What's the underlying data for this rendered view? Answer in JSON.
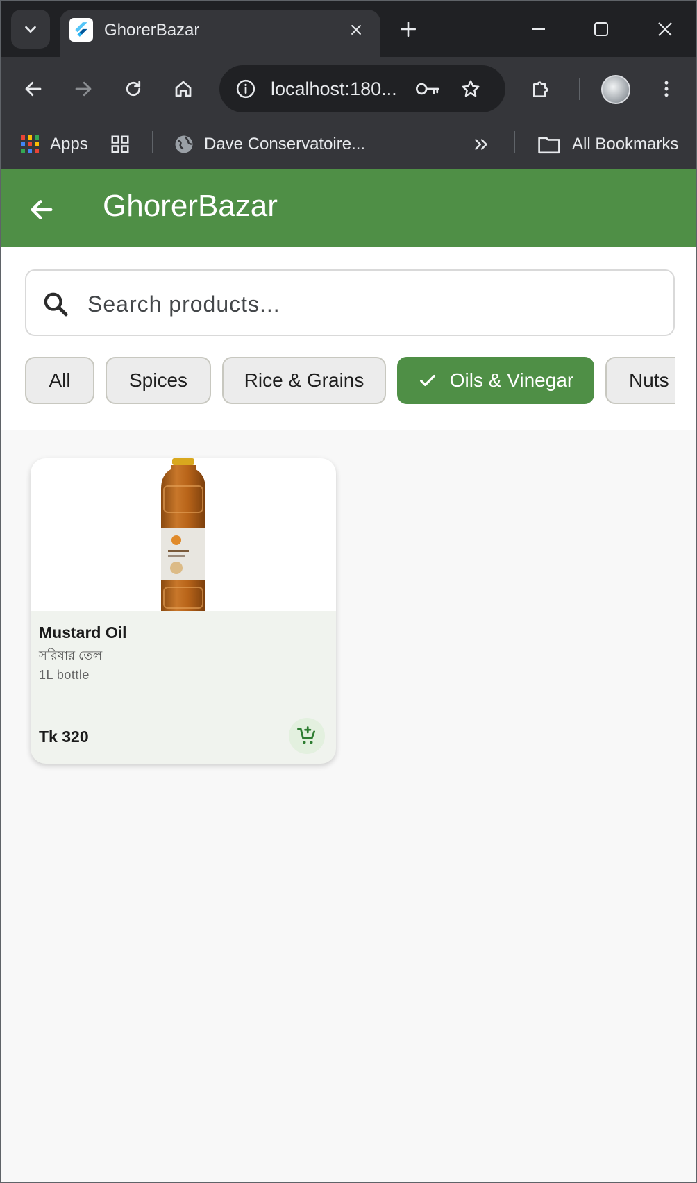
{
  "browser": {
    "tab_title": "GhorerBazar",
    "url": "localhost:180...",
    "bookmarks": {
      "apps_label": "Apps",
      "item_label": "Dave Conservatoire...",
      "all_bookmarks_label": "All Bookmarks"
    }
  },
  "app": {
    "title": "GhorerBazar",
    "search": {
      "placeholder": "Search products..."
    },
    "categories": [
      {
        "label": "All",
        "selected": false
      },
      {
        "label": "Spices",
        "selected": false
      },
      {
        "label": "Rice & Grains",
        "selected": false
      },
      {
        "label": "Oils & Vinegar",
        "selected": true
      },
      {
        "label": "Nuts",
        "selected": false
      }
    ],
    "products": [
      {
        "name": "Mustard Oil",
        "name_bn": "সরিষার তেল",
        "unit": "1L bottle",
        "price": "Tk 320"
      }
    ]
  },
  "colors": {
    "brand_green": "#4f8f46",
    "chrome_dark": "#202124",
    "chrome_mid": "#35363a",
    "cart_green": "#2e7d32"
  }
}
